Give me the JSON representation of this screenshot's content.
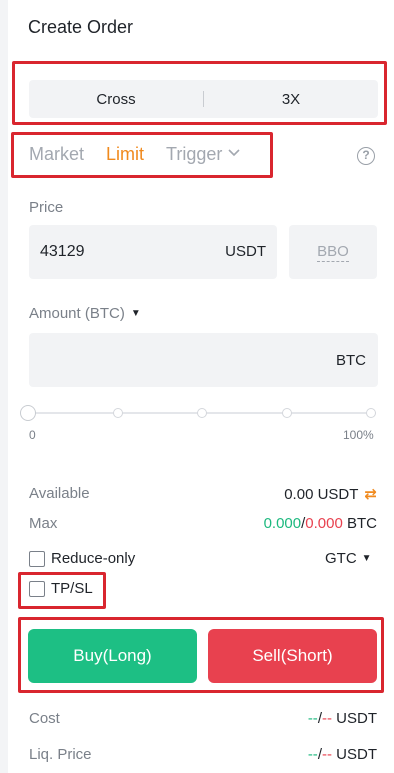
{
  "header": {
    "title": "Create Order"
  },
  "margin_mode": {
    "left": "Cross",
    "right": "3X"
  },
  "order_tabs": [
    {
      "label": "Market"
    },
    {
      "label": "Limit"
    },
    {
      "label": "Trigger"
    }
  ],
  "active_tab": "Limit",
  "price": {
    "label": "Price",
    "value": "43129",
    "unit": "USDT",
    "bbo_label": "BBO"
  },
  "amount": {
    "label": "Amount (BTC)",
    "value": "",
    "unit": "BTC"
  },
  "slider": {
    "value_percent": 0,
    "min_label": "0",
    "max_label": "100%"
  },
  "available": {
    "label": "Available",
    "value": "0.00 USDT"
  },
  "max": {
    "label": "Max",
    "long_value": "0.000",
    "separator": "/",
    "short_value": "0.000",
    "unit": "BTC"
  },
  "reduce_only": {
    "label": "Reduce-only",
    "checked": false
  },
  "time_in_force": {
    "value": "GTC"
  },
  "tpsl": {
    "label": "TP/SL",
    "checked": false
  },
  "actions": {
    "buy_label": "Buy(Long)",
    "sell_label": "Sell(Short)"
  },
  "cost": {
    "label": "Cost",
    "long": "--",
    "separator": "/",
    "short": "--",
    "unit": "USDT"
  },
  "liq_price": {
    "label": "Liq. Price",
    "long": "--",
    "separator": "/",
    "short": "--",
    "unit": "USDT"
  },
  "colors": {
    "accent": "#f08a1e",
    "buy": "#1dbf84",
    "sell": "#e8414f",
    "highlight": "#d9262f"
  }
}
